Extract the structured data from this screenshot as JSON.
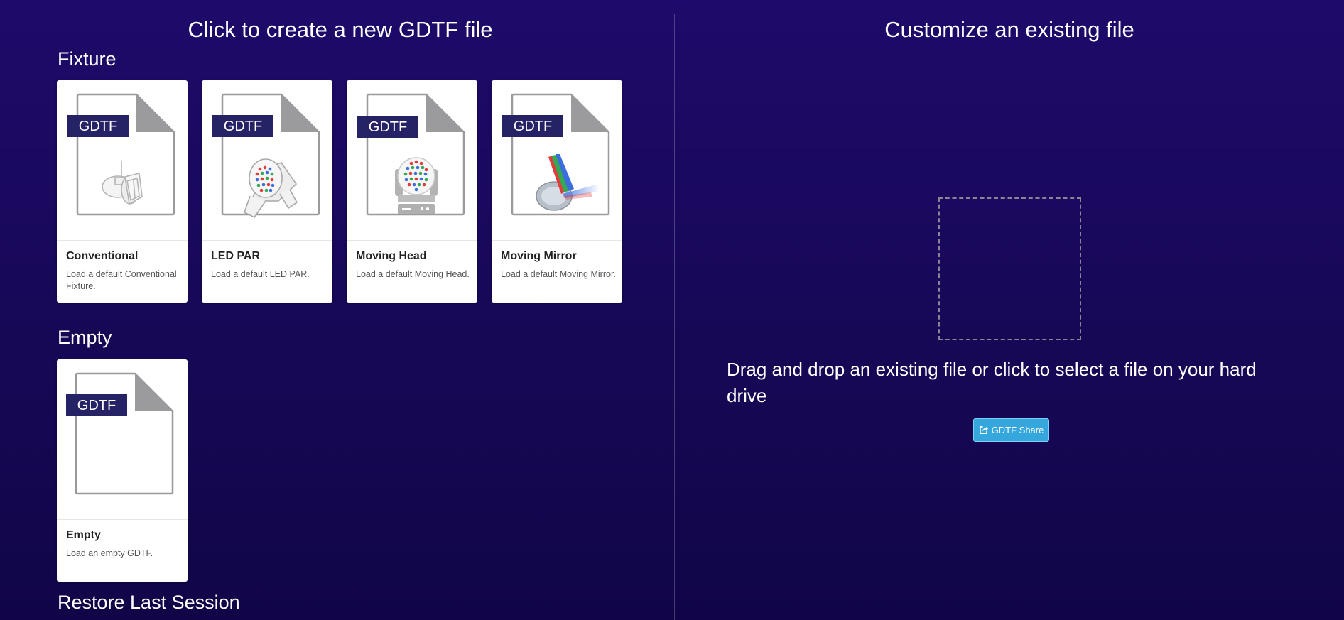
{
  "left": {
    "title": "Click to create a new GDTF file",
    "fixture_section": "Fixture",
    "empty_section": "Empty",
    "restore_section": "Restore Last Session"
  },
  "cards": {
    "conventional": {
      "badge": "GDTF",
      "title": "Conventional",
      "desc": "Load a default Conventional Fixture.",
      "icon": "conventional-fixture-icon"
    },
    "led_par": {
      "badge": "GDTF",
      "title": "LED PAR",
      "desc": "Load a default LED PAR.",
      "icon": "led-par-icon"
    },
    "moving_head": {
      "badge": "GDTF",
      "title": "Moving Head",
      "desc": "Load a default Moving Head.",
      "icon": "moving-head-icon"
    },
    "moving_mirror": {
      "badge": "GDTF",
      "title": "Moving Mirror",
      "desc": "Load a default Moving Mirror.",
      "icon": "moving-mirror-icon"
    },
    "empty": {
      "badge": "GDTF",
      "title": "Empty",
      "desc": "Load an empty GDTF.",
      "icon": "gdtf-file-icon"
    }
  },
  "right": {
    "title": "Customize an existing file",
    "drop_text": "Drag and drop an existing file or click to select a file on your hard drive",
    "share_button": "GDTF Share",
    "share_icon": "share-icon"
  },
  "colors": {
    "background": "#1a0860",
    "badge": "#262266",
    "accent_corner": "#4bb4e6",
    "share_button": "#35a7dd"
  }
}
